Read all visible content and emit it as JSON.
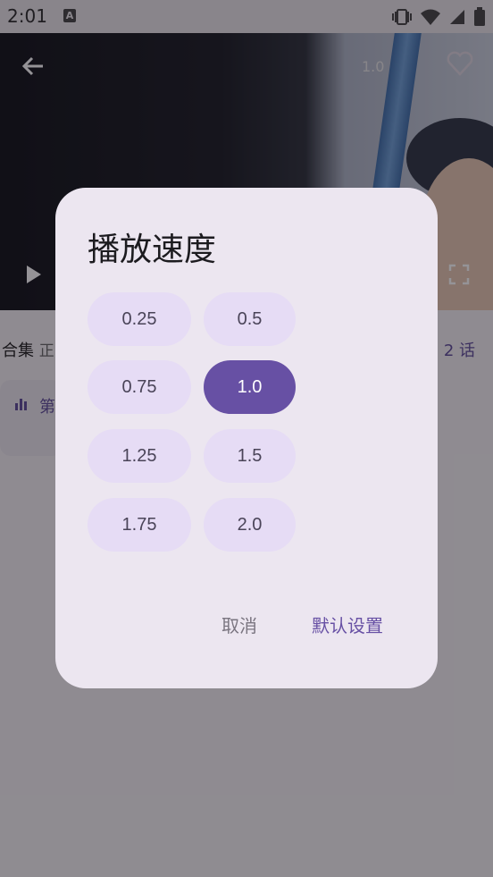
{
  "status_bar": {
    "time": "2:01",
    "notification_icon": "A"
  },
  "player": {
    "speed_badge": "1.0"
  },
  "below_video": {
    "collection_label": "合集",
    "collection_suffix": "正",
    "episode_count": "2 话",
    "episode_card_text": "第"
  },
  "dialog": {
    "title": "播放速度",
    "options": [
      "0.25",
      "0.5",
      "0.75",
      "1.0",
      "1.25",
      "1.5",
      "1.75",
      "2.0"
    ],
    "selected": "1.0",
    "cancel_label": "取消",
    "default_label": "默认设置"
  },
  "colors": {
    "accent": "#6750a4",
    "chip_bg": "#e6dcf5",
    "dialog_bg": "#ece6f0"
  }
}
